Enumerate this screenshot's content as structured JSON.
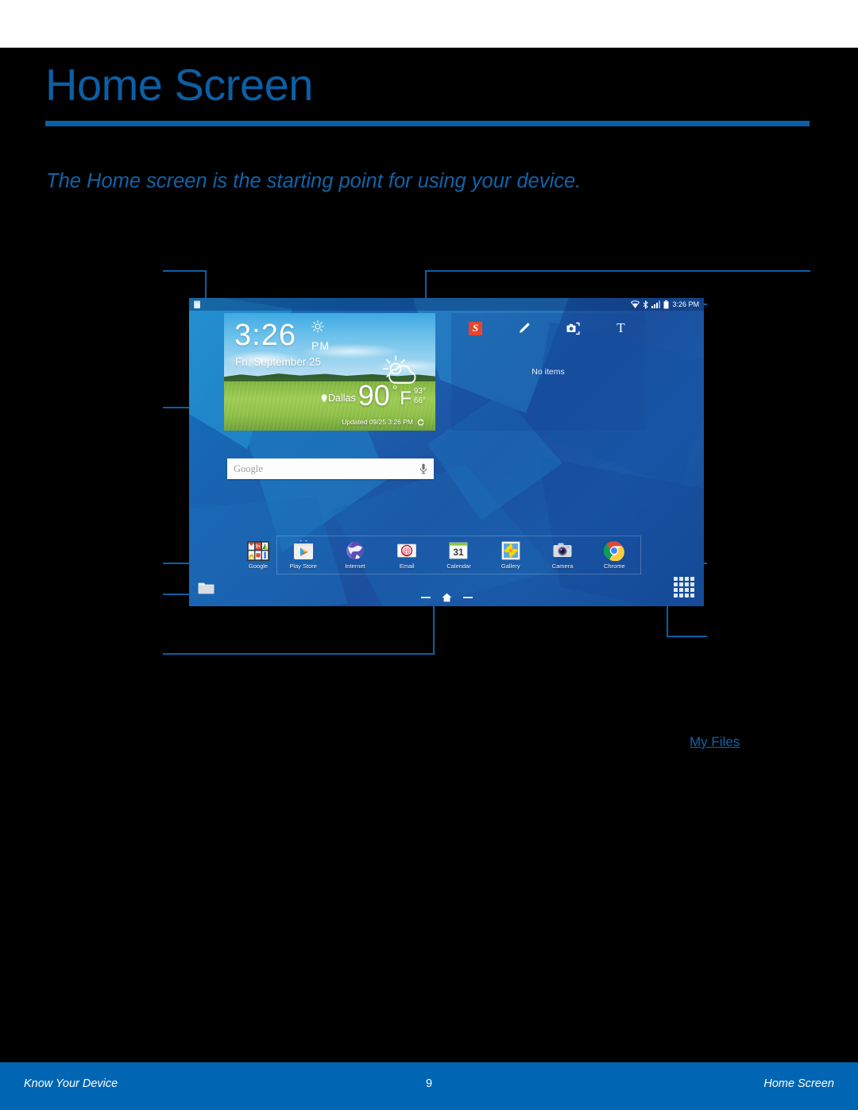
{
  "header": {
    "title": "Home Screen",
    "subtitle": "The Home screen is the starting point for using your device."
  },
  "links": {
    "my_files": "My Files"
  },
  "device": {
    "status_bar": {
      "time": "3:26 PM",
      "icons": [
        "notification-icon",
        "wifi-icon",
        "bluetooth-icon",
        "signal-icon",
        "battery-icon"
      ]
    },
    "weather_widget": {
      "time": "3:26",
      "am_pm": "PM",
      "date": "Fri, September 25",
      "city": "Dallas",
      "temperature": "90",
      "degree_symbol": "°",
      "unit": "F",
      "high": "93°",
      "low": "66°",
      "updated": "Updated 09/25 3:26 PM",
      "condition_icon": "sun-behind-cloud-icon",
      "refresh_icon": "refresh-icon",
      "location_icon": "location-pin-icon"
    },
    "scrapbook_widget": {
      "logo_letter": "S",
      "tools": [
        "scrapbook-logo-icon",
        "pen-icon",
        "camera-capture-icon",
        "text-tool-icon"
      ],
      "text_tool_letter": "T",
      "empty_message": "No items"
    },
    "search_bar": {
      "placeholder": "Google",
      "mic_icon": "microphone-icon"
    },
    "folder": {
      "label": "Google"
    },
    "apps": [
      {
        "label": "Play Store",
        "icon": "play-store-icon"
      },
      {
        "label": "Internet",
        "icon": "internet-globe-icon"
      },
      {
        "label": "Email",
        "icon": "email-at-icon"
      },
      {
        "label": "Calendar",
        "icon": "calendar-icon",
        "day": "31"
      },
      {
        "label": "Gallery",
        "icon": "gallery-flower-icon"
      },
      {
        "label": "Camera",
        "icon": "camera-icon"
      },
      {
        "label": "Chrome",
        "icon": "chrome-icon"
      }
    ],
    "bottom_shortcuts": {
      "my_files_folder_icon": "folder-icon",
      "apps_button_icon": "apps-grid-icon"
    },
    "nav_bar": {
      "home_icon": "home-icon"
    }
  },
  "colors": {
    "accent_blue": "#0B5FA5",
    "link_blue": "#1163A8",
    "footer_blue": "#0066B3",
    "page_background": "#000000"
  },
  "footer": {
    "left": "Know Your Device",
    "page_number": "9",
    "right": "Home Screen"
  }
}
